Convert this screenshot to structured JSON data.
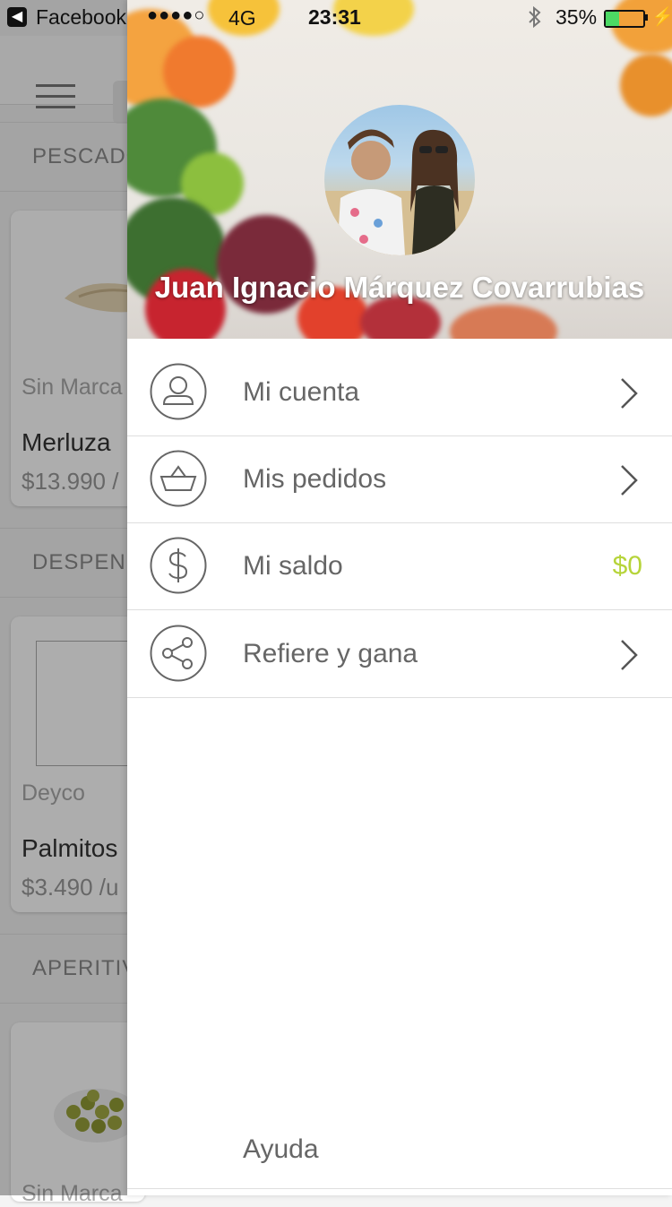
{
  "status_bar": {
    "back_app": "Facebook",
    "signal_dots": "●●●●○",
    "network": "4G",
    "time": "23:31",
    "battery_percent": "35%",
    "battery_level": 0.35
  },
  "background_app": {
    "sections": [
      {
        "title": "PESCADO",
        "product": {
          "brand": "Sin Marca",
          "name": "Merluza",
          "price": "$13.990 /"
        }
      },
      {
        "title": "DESPENS",
        "product": {
          "brand": "Deyco",
          "name": "Palmitos",
          "price": "$3.490 /u"
        }
      },
      {
        "title": "APERITIV",
        "product": {
          "brand": "Sin Marca",
          "name": "",
          "price": ""
        }
      }
    ]
  },
  "drawer": {
    "user_name": "Juan Ignacio Márquez Covarrubias",
    "menu": [
      {
        "label": "Mi cuenta",
        "icon": "user-icon"
      },
      {
        "label": "Mis pedidos",
        "icon": "basket-icon"
      },
      {
        "label": "Mi saldo",
        "icon": "dollar-icon",
        "value": "$0"
      },
      {
        "label": "Refiere y gana",
        "icon": "share-icon"
      }
    ],
    "help_label": "Ayuda",
    "accent_color": "#b6d43a"
  }
}
